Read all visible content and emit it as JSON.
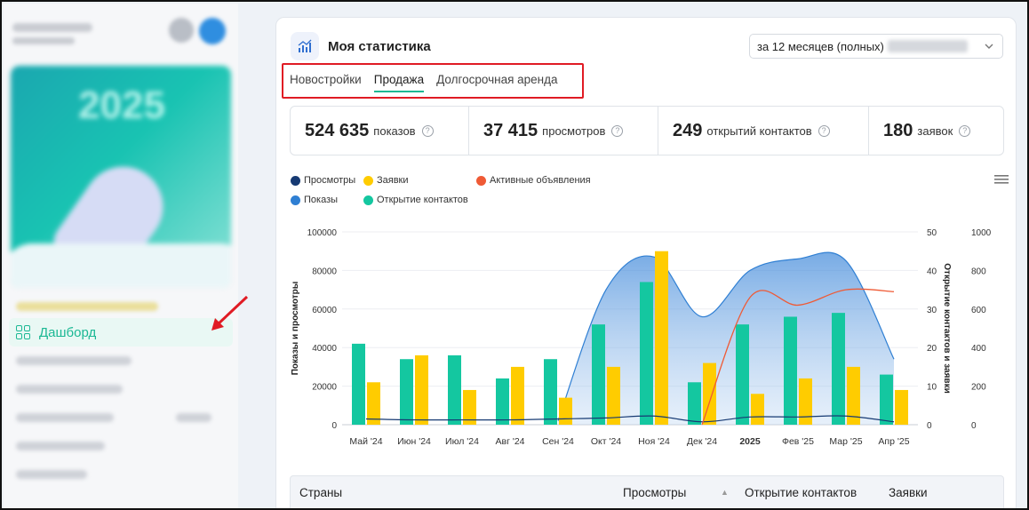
{
  "header": {
    "title": "Моя статистика",
    "period_label": "за 12 месяцев (полных)"
  },
  "tabs": [
    {
      "label": "Новостройки",
      "active": false
    },
    {
      "label": "Продажа",
      "active": true
    },
    {
      "label": "Долгосрочная аренда",
      "active": false
    }
  ],
  "stats": [
    {
      "value": "524 635",
      "label": "показов"
    },
    {
      "value": "37 415",
      "label": "просмотров"
    },
    {
      "value": "249",
      "label": "открытий контактов"
    },
    {
      "value": "180",
      "label": "заявок"
    }
  ],
  "sidebar": {
    "active_item": "Дашборд"
  },
  "table": {
    "columns": [
      "Страны",
      "Просмотры",
      "Открытие контактов",
      "Заявки"
    ]
  },
  "colors": {
    "accent": "#1bb894",
    "views": "#163a73",
    "shows": "#2f7fd3",
    "requests": "#ffcc00",
    "contacts": "#14c7a0",
    "active_ads": "#ef5a35",
    "annotation": "#e01b24"
  },
  "chart_data": {
    "type": "bar",
    "categories": [
      "Май '24",
      "Июн '24",
      "Июл '24",
      "Авг '24",
      "Сен '24",
      "Окт '24",
      "Ноя '24",
      "Дек '24",
      "2025",
      "Фев '25",
      "Мар '25",
      "Апр '25"
    ],
    "ylabel_left": "Показы и просмотры",
    "ylabel_right": "Открытие контактов и заявки",
    "ylim_left": [
      0,
      100000
    ],
    "ylim_right_inner": [
      0,
      50
    ],
    "ylim_right_outer": [
      0,
      1000
    ],
    "left_ticks": [
      0,
      20000,
      40000,
      60000,
      80000,
      100000
    ],
    "right_inner_ticks": [
      0,
      10,
      20,
      30,
      40,
      50
    ],
    "right_outer_ticks": [
      0,
      200,
      400,
      600,
      800,
      1000
    ],
    "legend_position": "top-left",
    "series": [
      {
        "name": "Просмотры",
        "kind": "line",
        "axis": "left",
        "values": [
          3000,
          2500,
          2500,
          2500,
          3000,
          3500,
          4500,
          1500,
          4000,
          4000,
          4500,
          1500
        ]
      },
      {
        "name": "Показы",
        "kind": "area",
        "axis": "left",
        "values": [
          null,
          null,
          null,
          null,
          2000,
          70000,
          87000,
          56000,
          80000,
          86000,
          85000,
          34000
        ]
      },
      {
        "name": "Заявки",
        "kind": "bar",
        "axis": "right_inner",
        "values": [
          11,
          18,
          9,
          15,
          7,
          15,
          45,
          16,
          8,
          12,
          15,
          9
        ]
      },
      {
        "name": "Открытие контактов",
        "kind": "bar",
        "axis": "right_inner",
        "values": [
          21,
          17,
          18,
          12,
          17,
          26,
          37,
          11,
          26,
          28,
          29,
          13
        ]
      },
      {
        "name": "Активные объявления",
        "kind": "line",
        "axis": "right_outer",
        "values": [
          null,
          null,
          null,
          null,
          null,
          null,
          null,
          0,
          660,
          620,
          700,
          690
        ]
      }
    ]
  }
}
